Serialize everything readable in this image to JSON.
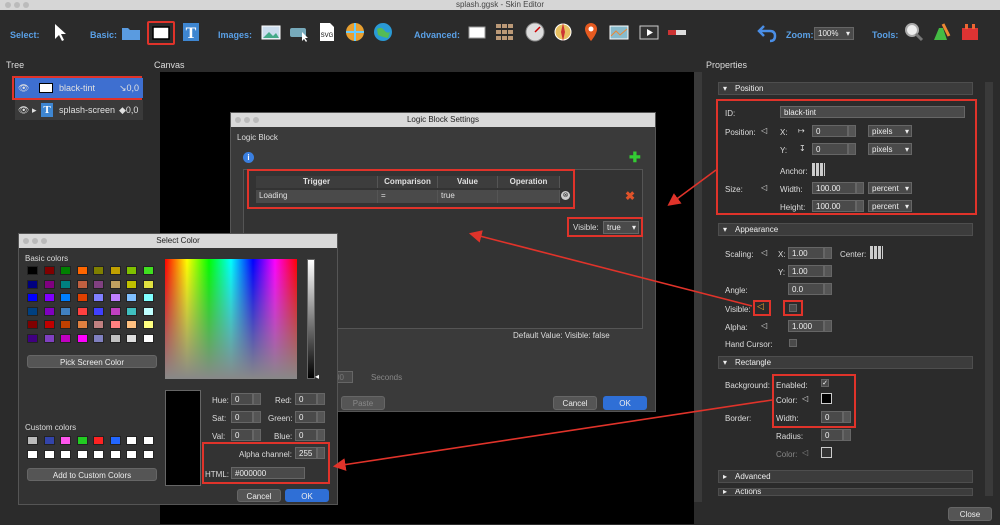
{
  "window": {
    "title": "splash.ggsk - Skin Editor"
  },
  "toolbar": {
    "select_label": "Select:",
    "basic_label": "Basic:",
    "images_label": "Images:",
    "advanced_label": "Advanced:",
    "zoom_label": "Zoom:",
    "zoom_value": "100%",
    "tools_label": "Tools:"
  },
  "tree": {
    "title": "Tree",
    "items": [
      {
        "label": "black-tint",
        "pos": "↘0,0"
      },
      {
        "label": "splash-screen",
        "pos": "◆0,0"
      }
    ]
  },
  "canvas": {
    "title": "Canvas"
  },
  "logic_dialog": {
    "title": "Logic Block Settings",
    "section": "Logic Block",
    "columns": [
      "Trigger",
      "Comparison",
      "Value",
      "Operation"
    ],
    "row": {
      "trigger": "Loading",
      "comparison": "=",
      "value": "true",
      "operation": ""
    },
    "visible_label": "Visible:",
    "visible_value": "true",
    "default_value": "Default Value:   Visible:  false",
    "seconds_value": "00",
    "seconds_label": "Seconds",
    "paste": "Paste",
    "cancel": "Cancel",
    "ok": "OK"
  },
  "color_dialog": {
    "title": "Select Color",
    "basic_colors": "Basic colors",
    "pick_screen": "Pick Screen Color",
    "custom_colors": "Custom colors",
    "add_custom": "Add to Custom Colors",
    "hue_label": "Hue:",
    "hue": "0",
    "sat_label": "Sat:",
    "sat": "0",
    "val_label": "Val:",
    "val": "0",
    "red_label": "Red:",
    "red": "0",
    "green_label": "Green:",
    "green": "0",
    "blue_label": "Blue:",
    "blue": "0",
    "alpha_label": "Alpha channel:",
    "alpha": "255",
    "html_label": "HTML:",
    "html": "#000000",
    "cancel": "Cancel",
    "ok": "OK",
    "palette": [
      "#000000",
      "#7f0000",
      "#008000",
      "#ff6600",
      "#808000",
      "#c0a000",
      "#80c000",
      "#40e020",
      "#000080",
      "#800080",
      "#008080",
      "#c06040",
      "#804080",
      "#c0a060",
      "#c0c000",
      "#e0e040",
      "#0000ff",
      "#8000ff",
      "#0080ff",
      "#e04000",
      "#8080ff",
      "#c080ff",
      "#80c0ff",
      "#80ffff",
      "#004080",
      "#8000c0",
      "#4080c0",
      "#ff4040",
      "#4040ff",
      "#c040c0",
      "#40c0c0",
      "#c0ffff",
      "#800000",
      "#c00000",
      "#c04000",
      "#e08040",
      "#c08080",
      "#ff8080",
      "#ffc080",
      "#ffff80",
      "#400080",
      "#8040c0",
      "#c000c0",
      "#ff00ff",
      "#8080c0",
      "#c0c0c0",
      "#e0e0e0",
      "#ffffff"
    ],
    "custom": [
      "#bbbbbb",
      "#3344aa",
      "#ff55ee",
      "#22cc22",
      "#ff2222",
      "#2266ff",
      "#ffffff",
      "#ffffff",
      "#ffffff",
      "#ffffff",
      "#ffffff",
      "#ffffff",
      "#ffffff",
      "#ffffff",
      "#ffffff",
      "#ffffff"
    ]
  },
  "properties": {
    "title": "Properties",
    "position": {
      "header": "Position",
      "id_label": "ID:",
      "id": "black-tint",
      "position_label": "Position:",
      "x_label": "X:",
      "x": "0",
      "x_unit": "pixels",
      "y_label": "Y:",
      "y": "0",
      "y_unit": "pixels",
      "anchor_label": "Anchor:",
      "size_label": "Size:",
      "width_label": "Width:",
      "width": "100.00",
      "width_unit": "percent",
      "height_label": "Height:",
      "height": "100.00",
      "height_unit": "percent"
    },
    "appearance": {
      "header": "Appearance",
      "scaling_label": "Scaling:",
      "x_label": "X:",
      "x": "1.00",
      "center_label": "Center:",
      "y_label": "Y:",
      "y": "1.00",
      "angle_label": "Angle:",
      "angle": "0.0",
      "visible_label": "Visible:",
      "alpha_label": "Alpha:",
      "alpha": "1.000",
      "hand_cursor_label": "Hand Cursor:"
    },
    "rectangle": {
      "header": "Rectangle",
      "background_label": "Background:",
      "enabled_label": "Enabled:",
      "color_label": "Color:",
      "width_label": "Width:",
      "width": "0",
      "border_label": "Border:",
      "radius_label": "Radius:",
      "radius": "0",
      "border_color_label": "Color:"
    },
    "advanced": {
      "header": "Advanced"
    },
    "actions": {
      "header": "Actions"
    }
  },
  "footer": {
    "close": "Close"
  }
}
